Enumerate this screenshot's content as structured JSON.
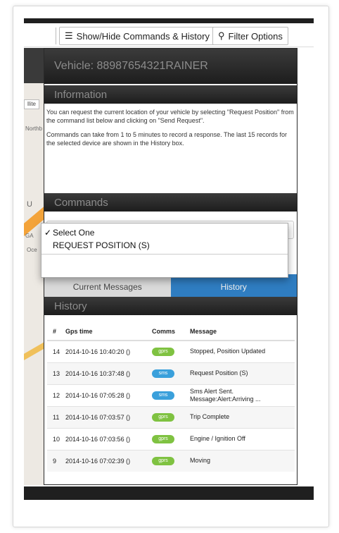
{
  "toolbar": {
    "show_hide_label": "Show/Hide Commands & History",
    "show_hide_icon": "list-icon",
    "filter_label": "Filter Options",
    "filter_icon": "search-icon"
  },
  "map": {
    "satellite_label": "llite",
    "street_label_1": "Northb",
    "street_label_2": "U",
    "street_label_3": "GA",
    "street_label_4": "Oce"
  },
  "vehicle": {
    "title": "Vehicle:  88987654321RAINER"
  },
  "information": {
    "heading": "Information",
    "para1": "You can request the current location of your vehicle by selecting \"Request Position\" from the command list below and clicking on \"Send Request\".",
    "para2": "Commands can take from 1 to 5 minutes to record a response. The last 15 records for the selected device are shown in the History box."
  },
  "commands": {
    "heading": "Commands",
    "options": [
      "Select One",
      "REQUEST POSITION (S)"
    ],
    "selected": "Select One"
  },
  "tabs": {
    "current": "Current Messages",
    "history": "History"
  },
  "history": {
    "heading": "History",
    "columns": [
      "#",
      "Gps time",
      "Comms",
      "Message"
    ],
    "rows": [
      {
        "num": "14",
        "time": "2014-10-16 10:40:20 ()",
        "comms": "gprs",
        "message": "Stopped, Position Updated"
      },
      {
        "num": "13",
        "time": "2014-10-16 10:37:48 ()",
        "comms": "sms",
        "message": "Request Position (S)"
      },
      {
        "num": "12",
        "time": "2014-10-16 07:05:28 ()",
        "comms": "sms",
        "message": "Sms Alert Sent. Message:Alert:Arriving ..."
      },
      {
        "num": "11",
        "time": "2014-10-16 07:03:57 ()",
        "comms": "gprs",
        "message": "Trip Complete"
      },
      {
        "num": "10",
        "time": "2014-10-16 07:03:56 ()",
        "comms": "gprs",
        "message": "Engine / Ignition Off"
      },
      {
        "num": "9",
        "time": "2014-10-16 07:02:39 ()",
        "comms": "gprs",
        "message": "Moving"
      }
    ]
  },
  "colors": {
    "header": "#1d1d1d",
    "tab_active": "#2f7dc1",
    "gprs": "#7fc241",
    "sms": "#3aa0db"
  }
}
